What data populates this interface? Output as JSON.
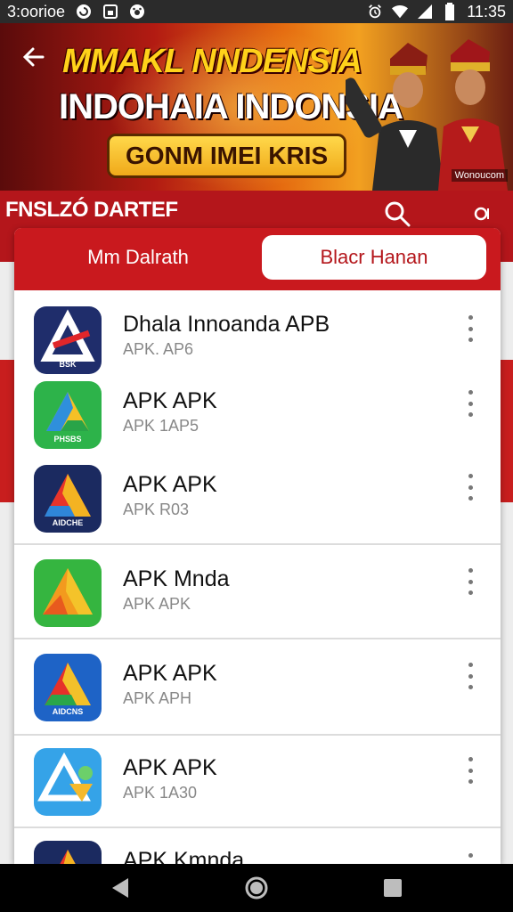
{
  "status_bar": {
    "left_text": "3:oorioe",
    "time": "11:35",
    "left_icons": [
      "sync-icon",
      "square-notification-icon",
      "paw-notification-icon"
    ],
    "right_icons": [
      "alarm-icon",
      "wifi-icon",
      "signal-icon",
      "battery-icon"
    ]
  },
  "banner": {
    "title_line1": "MMAKL NNDENSIA",
    "title_line2": "INDOHAIA INDONSIA",
    "pill_text": "GONM IMEI KRIS",
    "badge": "Wonoucom",
    "colors": {
      "yellow": "#ffd21a",
      "red": "#b21b12",
      "orange": "#e56b10"
    }
  },
  "header": {
    "title": "FNSLZÓ DARTEF"
  },
  "tabs": [
    {
      "label": "Mm Dalrath",
      "active": false
    },
    {
      "label": "Blacr Hanan",
      "active": true
    }
  ],
  "apps": [
    {
      "title": "Dhala Innoanda APB",
      "subtitle": "APK. AP6",
      "icon_label": "BSK",
      "icon_style": "navy"
    },
    {
      "title": "APK APK",
      "subtitle": "APK 1AP5",
      "icon_label": "PHSBS",
      "icon_style": "green"
    },
    {
      "title": "APK APK",
      "subtitle": "APK R03",
      "icon_label": "AIDCHE",
      "icon_style": "navy-color"
    },
    {
      "title": "APK Mnda",
      "subtitle": "APK APK",
      "icon_label": "",
      "icon_style": "green-orange"
    },
    {
      "title": "APK APK",
      "subtitle": "APK APH",
      "icon_label": "AIDCNS",
      "icon_style": "blue-color"
    },
    {
      "title": "APK APK",
      "subtitle": "APK 1A30",
      "icon_label": "",
      "icon_style": "light-blue"
    },
    {
      "title": "APK Kmnda",
      "subtitle": "",
      "icon_label": "",
      "icon_style": "navy-color"
    }
  ],
  "theme": {
    "primary": "#c9191e",
    "accent_text": "#b4161b",
    "divider": "#dcdcdc"
  }
}
